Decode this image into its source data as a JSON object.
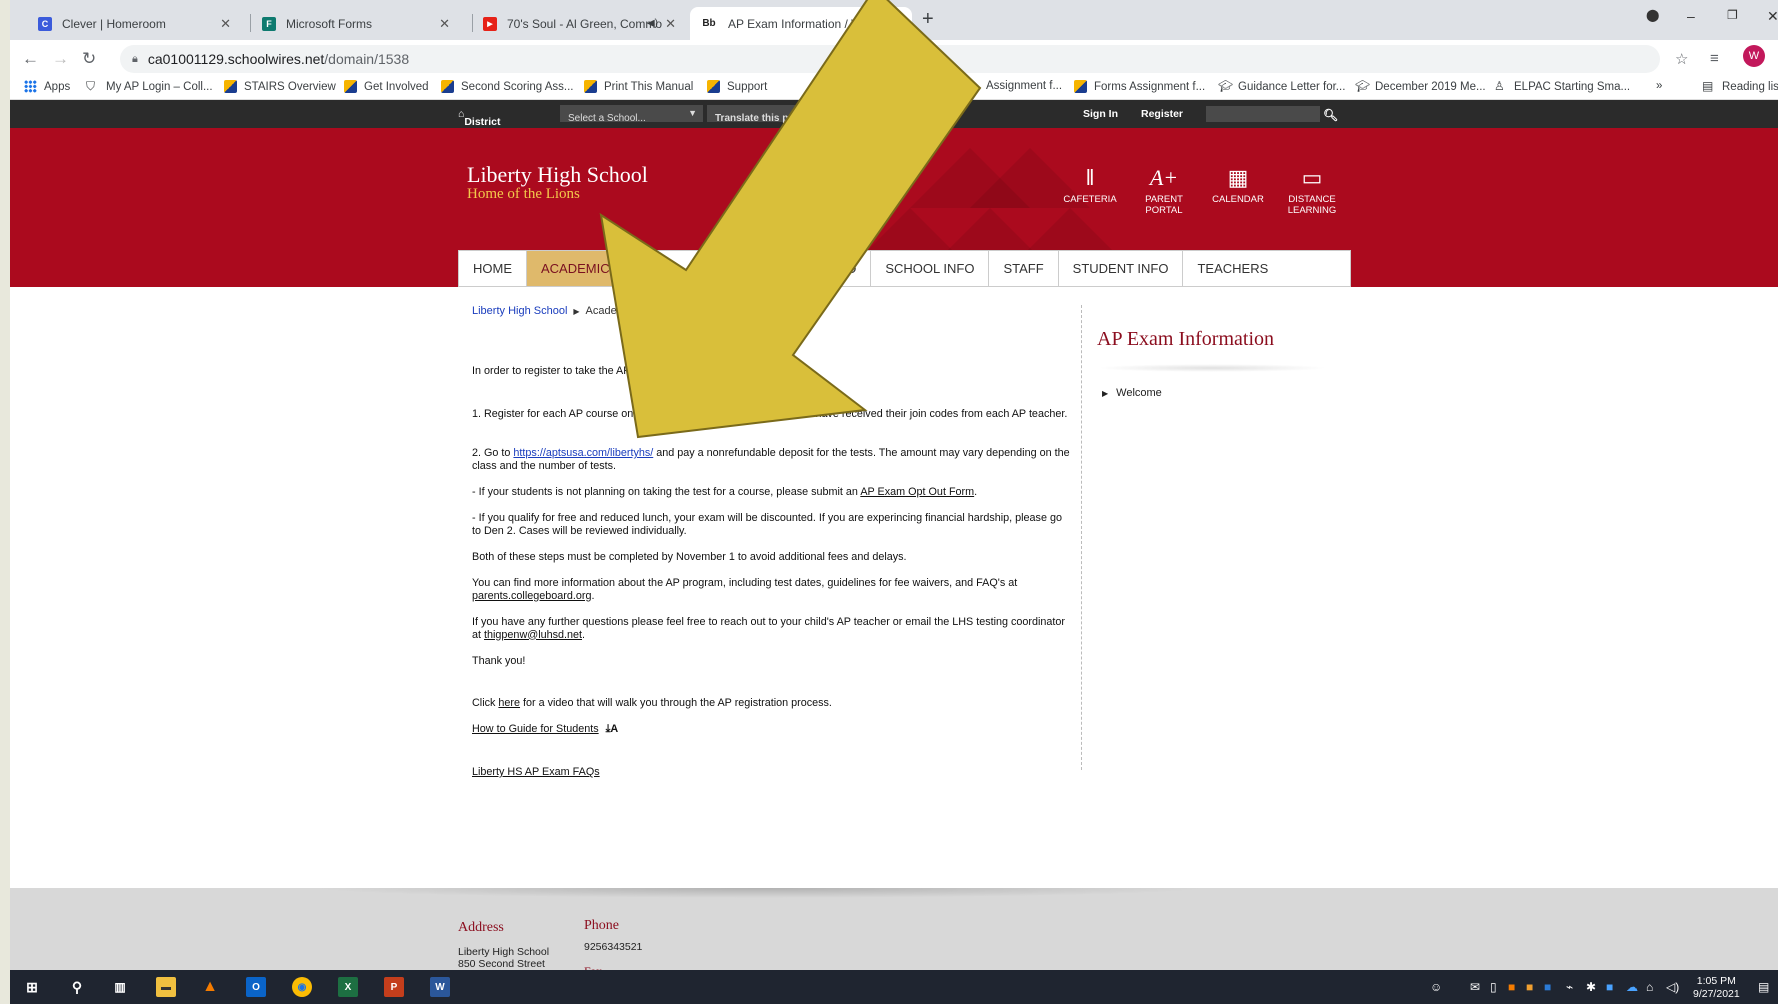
{
  "browser": {
    "tabs": [
      {
        "title": "Clever | Homeroom",
        "fav": "C",
        "fav_color": "#3b5bdb"
      },
      {
        "title": "Microsoft Forms",
        "fav": "F",
        "fav_color": "#0e7a6f"
      },
      {
        "title": "70's Soul - Al Green, Commo",
        "fav": "▶",
        "fav_color": "#e62117"
      },
      {
        "title": "AP Exam Information / We",
        "fav": "Bb",
        "fav_color": "#222222"
      }
    ],
    "url_host": "ca01001129.schoolwires.net",
    "url_path": "/domain/1538",
    "avatar_letter": "W"
  },
  "bookmarks": [
    "Apps",
    "My AP Login – Coll...",
    "STAIRS Overview",
    "Get Involved",
    "Second Scoring Ass...",
    "Print This Manual",
    "Support",
    "Assignment f...",
    "Forms Assignment f...",
    "Guidance Letter for...",
    "December 2019 Me...",
    "ELPAC Starting Sma...",
    "Reading list"
  ],
  "district": {
    "home": "District Home",
    "select_school": "Select a School...",
    "translate": "Translate this p",
    "sign_in": "Sign In",
    "register": "Register"
  },
  "school": {
    "name": "Liberty High School",
    "tagline": "Home of the Lions",
    "quick_links": [
      {
        "label": "CAFETERIA",
        "icon": "utensils-icon"
      },
      {
        "label": "PARENT PORTAL",
        "icon": "a-plus-icon"
      },
      {
        "label": "CALENDAR",
        "icon": "calendar-icon"
      },
      {
        "label": "DISTANCE LEARNING",
        "icon": "laptop-icon"
      }
    ]
  },
  "nav": [
    "HOME",
    "ACADEMICS",
    "",
    "INFO",
    "SCHOOL INFO",
    "STAFF",
    "STUDENT INFO",
    "TEACHERS"
  ],
  "breadcrumb": {
    "root": "Liberty High School",
    "current": "Academ"
  },
  "content": {
    "intro": "In order to register to take the AP",
    "step1": "1. Register for each AP course on",
    "step1_cont": "dents should have received their join codes from each AP teacher.",
    "step2_pre": "2. Go to ",
    "step2_link": "https://aptsusa.com/libertyhs/",
    "step2_post": " and pay a nonrefundable deposit for the tests. The amount may vary depending on the class and the number of tests.",
    "optout_pre": "- If your students is not planning on taking the test for a course, please submit an ",
    "optout_link": "AP Exam Opt Out Form",
    "optout_post": ".",
    "lunch": "- If you qualify for free and reduced lunch, your exam will be discounted. If you are experincing financial hardship, please go to Den 2. Cases will be reviewed individually.",
    "deadline": "Both of these steps must be completed by November 1 to avoid additional fees and delays.",
    "more_pre": "You can find more information about the AP program, including test dates, guidelines for fee waivers, and FAQ's at ",
    "more_link": "parents.collegeboard.org",
    "more_post": ".",
    "questions_pre": "If you have any further questions please feel free to reach out to your child's AP teacher or email the LHS testing coordinator at ",
    "questions_link": "thigpenw@luhsd.net",
    "questions_post": ".",
    "thanks": "Thank you!",
    "video_pre": "Click ",
    "video_link": "here",
    "video_post": " for a video that will walk you through the AP registration process.",
    "guide_link": "How to Guide for Students",
    "faq_link": " Liberty HS AP Exam FAQs"
  },
  "sidebar": {
    "title": "AP Exam Information",
    "items": [
      "Welcome"
    ]
  },
  "footer": {
    "address_label": "Address",
    "address_line1": "Liberty High School",
    "address_line2": "850 Second Street",
    "phone_label": "Phone",
    "phone": "9256343521",
    "fax_label": "Fax"
  },
  "taskbar": {
    "time": "1:05 PM",
    "date": "9/27/2021"
  },
  "colors": {
    "header_red": "#ab0a1e",
    "nav_active": "#dfb96b",
    "arrow_fill": "#d9bf3a"
  }
}
